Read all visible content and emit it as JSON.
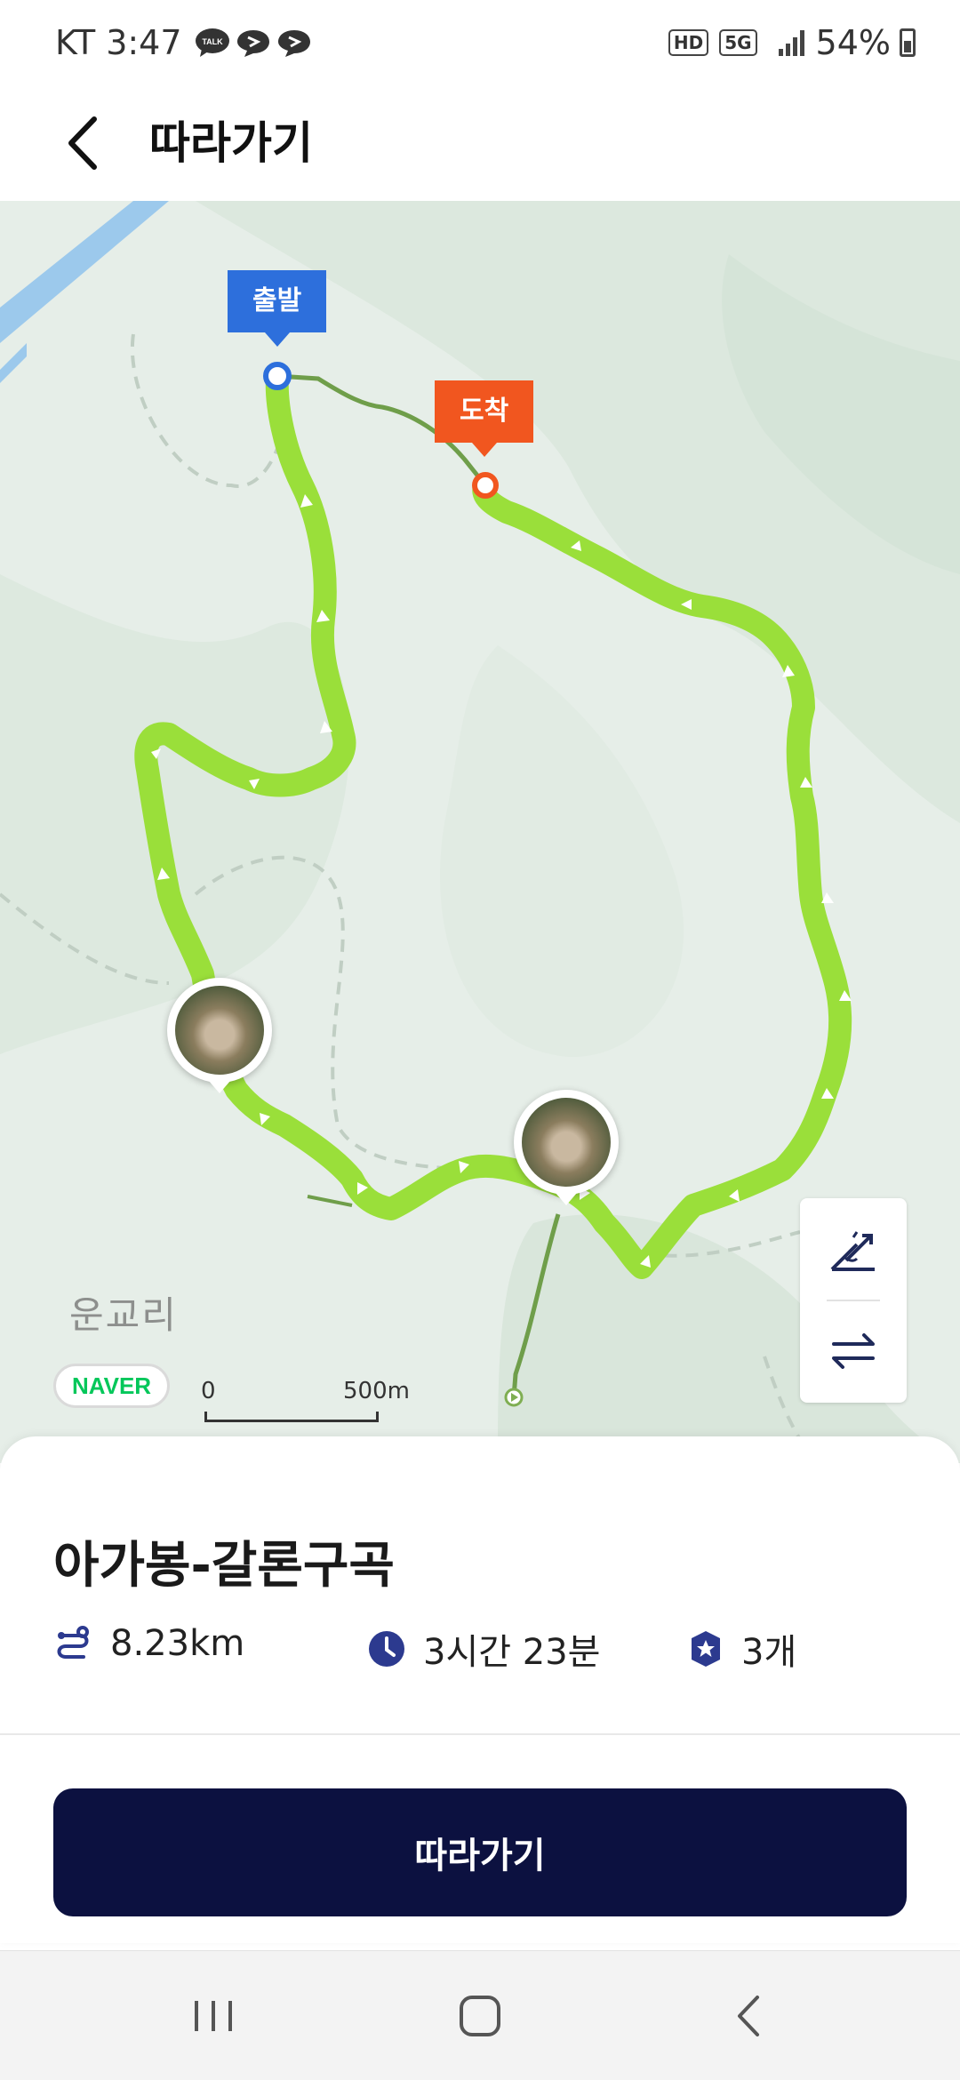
{
  "status_bar": {
    "carrier": "KT",
    "time": "3:47",
    "notif_label": "TALK",
    "hd_badge": "HD",
    "network": "5G",
    "battery": "54%"
  },
  "header": {
    "title": "따라가기"
  },
  "map": {
    "start_label": "출발",
    "end_label": "도착",
    "village": "운교리",
    "provider": "NAVER",
    "scale_start": "0",
    "scale_end": "500m",
    "route_color": "#9adf3a",
    "start_color": "#2d6fdc",
    "end_color": "#f1561f"
  },
  "route": {
    "name": "아가봉-갈론구곡",
    "distance": "8.23km",
    "duration": "3시간 23분",
    "waypoints": "3개"
  },
  "cta": {
    "label": "따라가기"
  }
}
